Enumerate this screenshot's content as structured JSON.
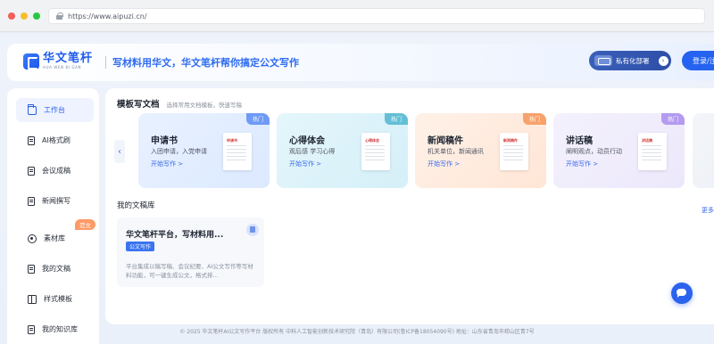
{
  "browser": {
    "url": "https://www.aipuzi.cn/"
  },
  "header": {
    "logo_name": "华文笔杆",
    "logo_sub": "HUA WEN BI GAN",
    "slogan": "写材料用华文，华文笔杆帮你搞定公文写作",
    "private_deploy_label": "私有化部署",
    "login_label": "登录/注册"
  },
  "sidebar": {
    "items": [
      {
        "label": "工作台",
        "icon": "folder-icon"
      },
      {
        "label": "AI格式刷",
        "icon": "document-icon"
      },
      {
        "label": "会议成稿",
        "icon": "document-icon"
      },
      {
        "label": "新闻撰写",
        "icon": "document-icon"
      },
      {
        "label": "素材库",
        "icon": "circle-icon",
        "badge": "范文"
      },
      {
        "label": "我的文稿",
        "icon": "document-icon"
      },
      {
        "label": "样式模板",
        "icon": "grid-icon"
      },
      {
        "label": "我的知识库",
        "icon": "document-icon"
      }
    ]
  },
  "templates": {
    "title": "模板写文档",
    "subtitle": "选择常用文档模板，快速写稿",
    "cards": [
      {
        "title": "申请书",
        "desc": "入团申请，入党申请",
        "start": "开始写作 >",
        "hot": "热门",
        "paper_title": "申请书"
      },
      {
        "title": "心得体会",
        "desc": "观后感 学习心得",
        "start": "开始写作 >",
        "hot": "热门",
        "paper_title": "心得体会"
      },
      {
        "title": "新闻稿件",
        "desc": "机关单位，新闻通讯",
        "start": "开始写作 >",
        "hot": "热门",
        "paper_title": "新闻稿件"
      },
      {
        "title": "讲话稿",
        "desc": "阐明观点，动员行动",
        "start": "开始写作 >",
        "hot": "热门",
        "paper_title": "讲话稿"
      }
    ]
  },
  "library": {
    "title": "我的文稿库",
    "more": "更多",
    "doc": {
      "title": "华文笔杆平台，写材料用...",
      "tag": "公文写作",
      "desc": "平台集成以稿写稿、会议纪要、AI公文写作等写材料功能，可一键生成公文，格式排..."
    }
  },
  "footer": {
    "text": "© 2025 华文笔杆AI公文写作平台 版权所有 中科人工智能创新技术研究院（青岛）有限公司(鲁ICP备18054090号) 地址：山东省青岛市崂山区青7号"
  },
  "colors": {
    "accent": "#2562ef",
    "brand": "#1f5cf0"
  }
}
